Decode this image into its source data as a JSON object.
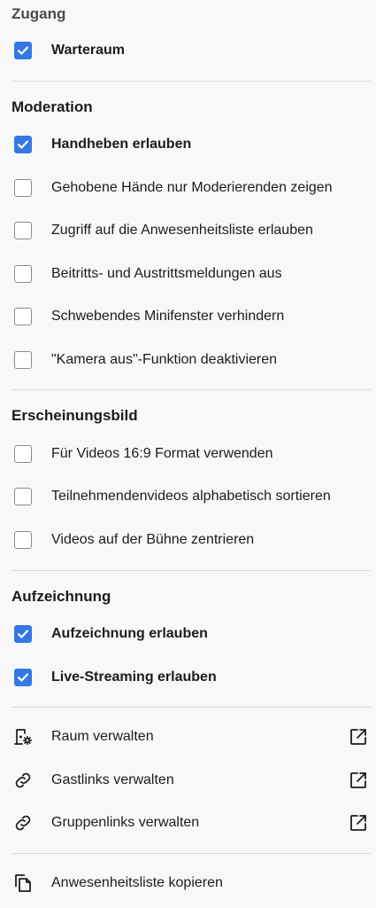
{
  "sections": {
    "access": {
      "title": "Zugang"
    },
    "moderation": {
      "title": "Moderation"
    },
    "appearance": {
      "title": "Erscheinungsbild"
    },
    "recording": {
      "title": "Aufzeichnung"
    }
  },
  "options": {
    "waiting_room": {
      "label": "Warteraum",
      "checked": true
    },
    "raise_hand": {
      "label": "Handheben erlauben",
      "checked": true
    },
    "raised_hands_mods_only": {
      "label": "Gehobene Hände nur Moderierenden zeigen",
      "checked": false
    },
    "attendee_list_access": {
      "label": "Zugriff auf die Anwesenheitsliste erlauben",
      "checked": false
    },
    "join_leave_messages_off": {
      "label": "Beitritts- und Austrittsmeldungen aus",
      "checked": false
    },
    "prevent_floating_window": {
      "label": "Schwebendes Minifenster verhindern",
      "checked": false
    },
    "disable_camera_off": {
      "label": "\"Kamera aus\"-Funktion deaktivieren",
      "checked": false
    },
    "videos_16_9": {
      "label": "Für Videos 16:9 Format verwenden",
      "checked": false
    },
    "sort_videos_alpha": {
      "label": "Teilnehmendenvideos alphabetisch sortieren",
      "checked": false
    },
    "center_stage_videos": {
      "label": "Videos auf der Bühne zentrieren",
      "checked": false
    },
    "allow_recording": {
      "label": "Aufzeichnung erlauben",
      "checked": true
    },
    "allow_streaming": {
      "label": "Live-Streaming erlauben",
      "checked": true
    }
  },
  "actions": {
    "manage_room": {
      "label": "Raum verwalten",
      "icon": "room-settings-icon"
    },
    "manage_guest_links": {
      "label": "Gastlinks verwalten",
      "icon": "link-icon"
    },
    "manage_group_links": {
      "label": "Gruppenlinks verwalten",
      "icon": "link-icon"
    },
    "copy_attendee_list": {
      "label": "Anwesenheitsliste kopieren",
      "icon": "copy-icon"
    }
  },
  "colors": {
    "accent": "#3478e5",
    "background": "#f8f8f9",
    "divider": "#dcdcdf"
  }
}
